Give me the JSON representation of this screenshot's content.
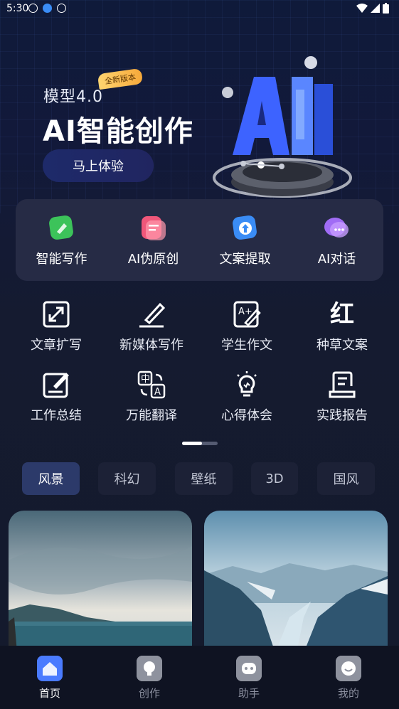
{
  "status_bar": {
    "time": "5:30"
  },
  "hero": {
    "subtitle": "模型4.0",
    "badge": "全新版本",
    "title": "AI智能创作",
    "cta_label": "马上体验",
    "art_text": "AI"
  },
  "features": [
    {
      "label": "智能写作",
      "icon": "pen-icon",
      "color": "#3cc35a"
    },
    {
      "label": "AI伪原创",
      "icon": "document-icon",
      "color": "#f0577a"
    },
    {
      "label": "文案提取",
      "icon": "upload-icon",
      "color": "#3a8cf5"
    },
    {
      "label": "AI对话",
      "icon": "chat-icon",
      "color": "#a06cf5"
    }
  ],
  "tools": [
    {
      "label": "文章扩写",
      "icon": "expand-icon"
    },
    {
      "label": "新媒体写作",
      "icon": "write-icon"
    },
    {
      "label": "学生作文",
      "icon": "essay-icon"
    },
    {
      "label": "种草文案",
      "icon": "red-note-icon",
      "glyph": "红"
    },
    {
      "label": "工作总结",
      "icon": "summary-icon"
    },
    {
      "label": "万能翻译",
      "icon": "translate-icon"
    },
    {
      "label": "心得体会",
      "icon": "lightbulb-icon"
    },
    {
      "label": "实践报告",
      "icon": "report-icon"
    }
  ],
  "categories": [
    "风景",
    "科幻",
    "壁纸",
    "3D",
    "国风"
  ],
  "active_category": "风景",
  "bottom_nav": [
    {
      "label": "首页",
      "icon": "home-icon",
      "active": true
    },
    {
      "label": "创作",
      "icon": "bulb-icon",
      "active": false
    },
    {
      "label": "助手",
      "icon": "assistant-icon",
      "active": false
    },
    {
      "label": "我的",
      "icon": "profile-icon",
      "active": false
    }
  ]
}
